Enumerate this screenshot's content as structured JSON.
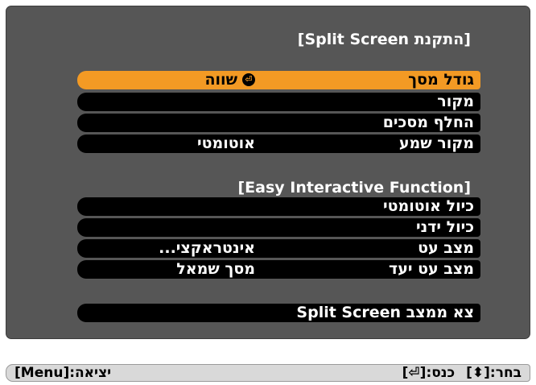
{
  "sections": {
    "split_title": "[התקנת Split Screen]",
    "eif_title": "[Easy Interactive Function]"
  },
  "split_items": [
    {
      "label": "גודל מסך",
      "value": "שווה"
    },
    {
      "label": "מקור",
      "value": ""
    },
    {
      "label": "החלף מסכים",
      "value": ""
    },
    {
      "label": "מקור שמע",
      "value": "אוטומטי"
    }
  ],
  "eif_items": [
    {
      "label": "כיול אוטומטי",
      "value": ""
    },
    {
      "label": "כיול ידני",
      "value": ""
    },
    {
      "label": "מצב עט",
      "value": "אינטראקצי..."
    },
    {
      "label": "מצב עט יעד",
      "value": "מסך שמאל"
    }
  ],
  "exit_item": {
    "label": "צא ממצב Split Screen"
  },
  "footer": {
    "exit_hint": "יציאה:[Menu]",
    "select_hint": "בחר:[⬍]",
    "enter_hint": "כנס:[⏎]"
  },
  "icons": {
    "enter": "enter-icon",
    "updown": "updown-arrow-icon"
  },
  "colors": {
    "panel": "#565656",
    "selected": "#f39a24",
    "item": "#000000"
  }
}
